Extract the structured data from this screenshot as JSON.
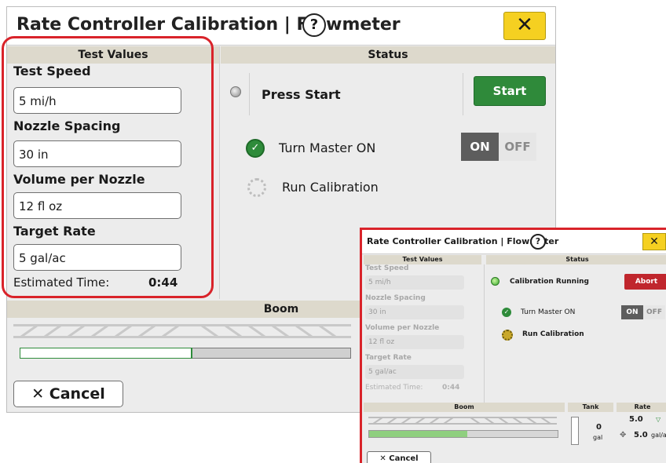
{
  "main": {
    "title": "Rate Controller Calibration | Flowmeter",
    "help_glyph": "?",
    "close_glyph": "✕",
    "test_values": {
      "header": "Test Values",
      "fields": [
        {
          "label": "Test Speed",
          "value": "5 mi/h"
        },
        {
          "label": "Nozzle Spacing",
          "value": "30 in"
        },
        {
          "label": "Volume per Nozzle",
          "value": "12 fl oz"
        },
        {
          "label": "Target Rate",
          "value": "5 gal/ac"
        }
      ],
      "estimated_time_label": "Estimated Time:",
      "estimated_time_value": "0:44"
    },
    "status": {
      "header": "Status",
      "step_start": "Press Start",
      "start_button": "Start",
      "step_master": "Turn Master ON",
      "toggle_on": "ON",
      "toggle_off": "OFF",
      "step_run": "Run Calibration"
    },
    "boom": {
      "header": "Boom",
      "progress": 0.52
    },
    "cancel_button": "Cancel",
    "cancel_glyph": "✕"
  },
  "inset": {
    "title": "Rate Controller Calibration | Flowmeter",
    "help_glyph": "?",
    "close_glyph": "✕",
    "test_values_header": "Test Values",
    "fields": [
      {
        "label": "Test Speed",
        "value": "5 mi/h"
      },
      {
        "label": "Nozzle Spacing",
        "value": "30 in"
      },
      {
        "label": "Volume per Nozzle",
        "value": "12 fl oz"
      },
      {
        "label": "Target Rate",
        "value": "5 gal/ac"
      }
    ],
    "estimated_time_label": "Estimated Time:",
    "estimated_time_value": "0:44",
    "status_header": "Status",
    "step_running": "Calibration Running",
    "abort_button": "Abort",
    "step_master": "Turn Master ON",
    "toggle_on": "ON",
    "toggle_off": "OFF",
    "step_run": "Run Calibration",
    "boom_header": "Boom",
    "boom_progress": 0.52,
    "tank_header": "Tank",
    "tank_value": "0",
    "tank_unit": "gal",
    "rate_header": "Rate",
    "rate_target": "5.0",
    "rate_actual": "5.0",
    "rate_unit": "gal/a",
    "cancel_button": "Cancel",
    "cancel_glyph": "✕"
  }
}
